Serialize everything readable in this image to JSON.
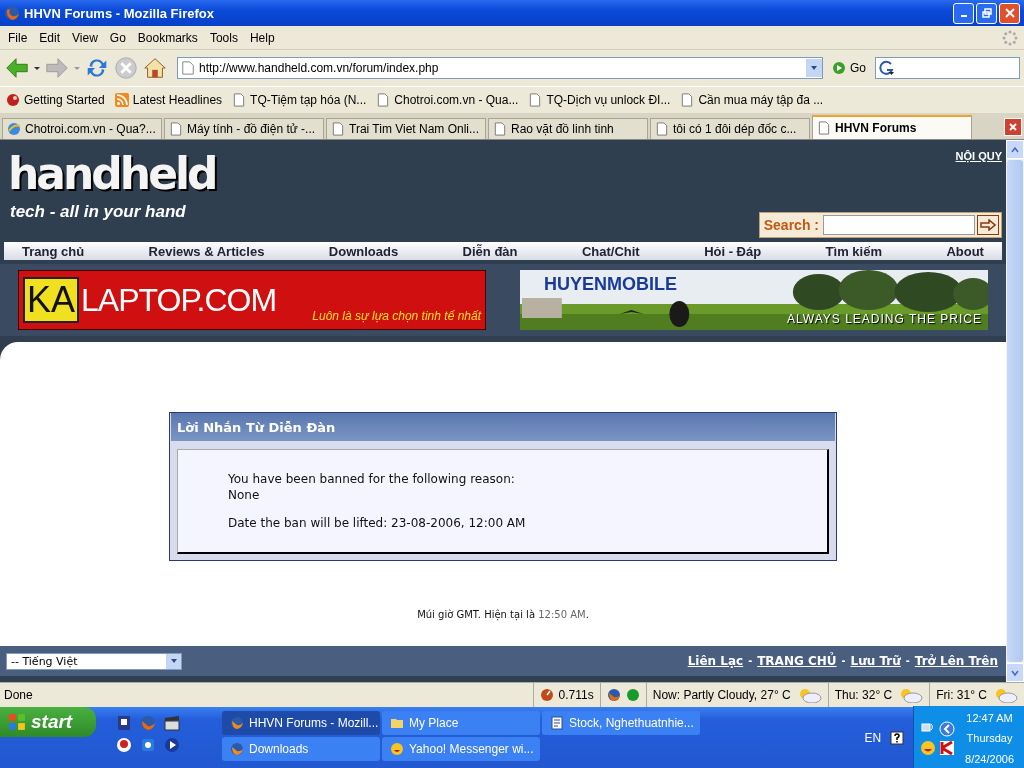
{
  "window": {
    "title": "HHVN Forums - Mozilla Firefox"
  },
  "menu": [
    "File",
    "Edit",
    "View",
    "Go",
    "Bookmarks",
    "Tools",
    "Help"
  ],
  "address": {
    "url": "http://www.handheld.com.vn/forum/index.php",
    "go": "Go"
  },
  "bookmarks": [
    {
      "label": "Getting Started",
      "kind": "site"
    },
    {
      "label": "Latest Headlines",
      "kind": "feed"
    },
    {
      "label": "TQ-Tiệm tạp hóa (N...",
      "kind": "page"
    },
    {
      "label": "Chotroi.com.vn - Qua...",
      "kind": "page"
    },
    {
      "label": "TQ-Dịch vụ unlock ĐI...",
      "kind": "page"
    },
    {
      "label": "Cần mua máy tập đa ...",
      "kind": "page"
    }
  ],
  "tabs": [
    {
      "label": "Chotroi.com.vn - Qua?...",
      "selected": false
    },
    {
      "label": "Máy tính - đồ điện tử -...",
      "selected": false
    },
    {
      "label": "Trai Tim Viet Nam Onli...",
      "selected": false
    },
    {
      "label": "Rao vặt đồ linh tinh",
      "selected": false
    },
    {
      "label": "tôi có 1 đôi dép đốc c...",
      "selected": false
    },
    {
      "label": "HHVN Forums",
      "selected": true
    }
  ],
  "page": {
    "logo": "handheld",
    "tagline": "tech - all in your hand",
    "rules_link": "NỘI QUY",
    "search_label": "Search :",
    "nav": [
      "Trang chủ",
      "Reviews & Articles",
      "Downloads",
      "Diễn đàn",
      "Chat/Chit",
      "Hỏi - Đáp",
      "Tìm kiếm",
      "About"
    ],
    "ads": [
      {
        "brand_a": "KA",
        "brand_b": "LAPTOP.COM",
        "slogan": "Luôn là sự lựa chọn tinh tế nhất"
      },
      {
        "brand": "HUYENMOBILE",
        "slogan": "ALWAYS LEADING THE PRICE",
        "kind": "picture"
      }
    ],
    "message": {
      "title": "Lời Nhắn Từ Diễn Đàn",
      "lines": [
        "You have been banned for the following reason:",
        "None"
      ],
      "lifted": "Date the ban will be lifted: 23-08-2006, 12:00 AM"
    },
    "timezone": {
      "text": "Múi giờ GMT. Hiện tại là",
      "time": "12:50 AM",
      "end": "."
    },
    "language": "-- Tiếng Việt",
    "footer_links": [
      "Liên Lạc",
      "TRANG CHỦ",
      "Lưu Trữ",
      "Trở Lên Trên"
    ],
    "footer_separator": "-"
  },
  "status_bar": {
    "text": "Done",
    "timing": "0.711s",
    "weather": [
      "Now: Partly Cloudy, 27° C",
      "Thu: 32° C",
      "Fri: 31° C"
    ]
  },
  "taskbar": {
    "start": "start",
    "windows": [
      {
        "label": "HHVN Forums - Mozill...",
        "kind": "browser",
        "selected": true
      },
      {
        "label": "My Place",
        "kind": "folder",
        "selected": false
      },
      {
        "label": "Stock, Nghethuatnhie...",
        "kind": "document",
        "selected": false
      },
      {
        "label": "Downloads",
        "kind": "browser",
        "selected": false
      },
      {
        "label": "Yahoo! Messenger wi...",
        "kind": "messenger",
        "selected": false
      }
    ],
    "language": "EN",
    "time": "12:47 AM",
    "day": "Thursday",
    "date": "8/24/2006"
  }
}
